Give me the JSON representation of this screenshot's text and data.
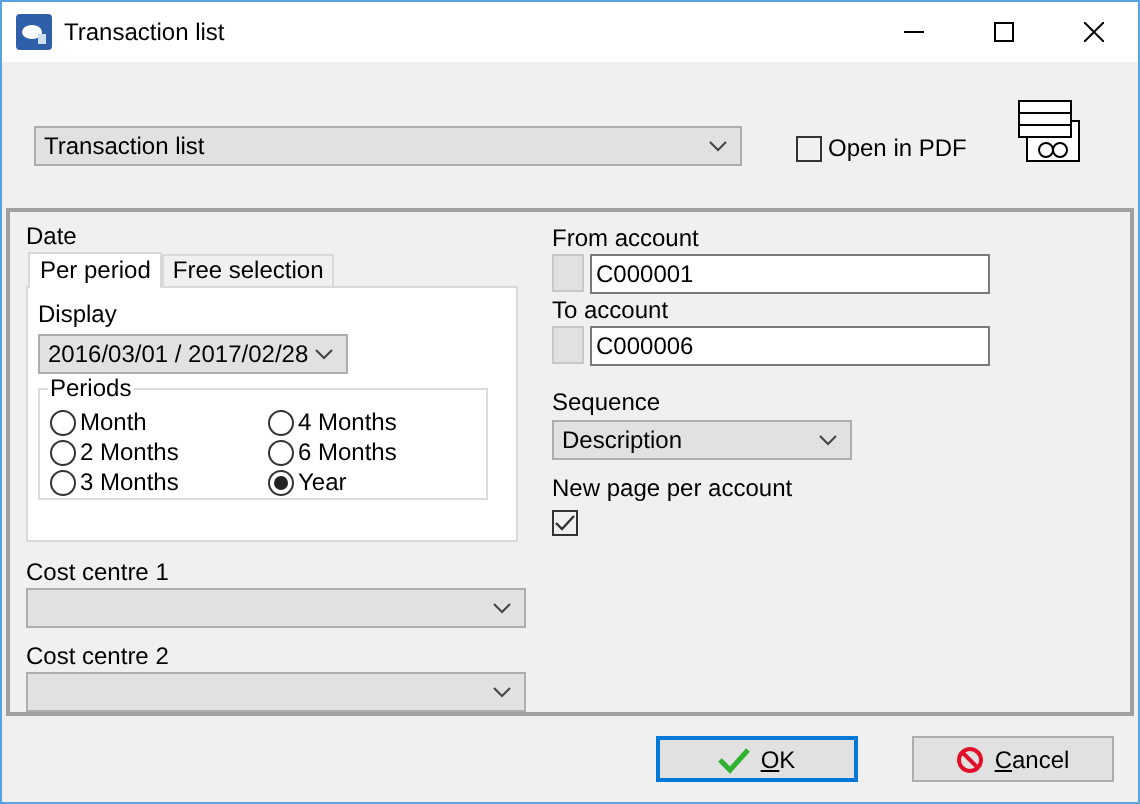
{
  "window": {
    "title": "Transaction list"
  },
  "report": {
    "value": "Transaction list"
  },
  "open_in_pdf": {
    "label": "Open in PDF",
    "checked": false
  },
  "date": {
    "label": "Date",
    "tabs": [
      {
        "label": "Per period",
        "selected": true
      },
      {
        "label": "Free selection",
        "selected": false
      }
    ],
    "display": {
      "label": "Display",
      "value": "2016/03/01 / 2017/02/28"
    },
    "periods": {
      "label": "Periods",
      "options": [
        {
          "label": "Month",
          "selected": false
        },
        {
          "label": "4 Months",
          "selected": false
        },
        {
          "label": "2 Months",
          "selected": false
        },
        {
          "label": "6 Months",
          "selected": false
        },
        {
          "label": "3 Months",
          "selected": false
        },
        {
          "label": "Year",
          "selected": true
        }
      ]
    }
  },
  "cost_centres": [
    {
      "label": "Cost centre 1"
    },
    {
      "label": "Cost centre 2"
    }
  ],
  "from_account": {
    "label": "From account",
    "value": "C000001"
  },
  "to_account": {
    "label": "To account",
    "value": "C000006"
  },
  "sequence": {
    "label": "Sequence",
    "value": "Description"
  },
  "new_page_per_account": {
    "label": "New page per account",
    "checked": true
  },
  "buttons": [
    {
      "label": "OK",
      "kind": "ok",
      "default": true
    },
    {
      "label": "Cancel",
      "kind": "cancel",
      "default": false
    }
  ]
}
